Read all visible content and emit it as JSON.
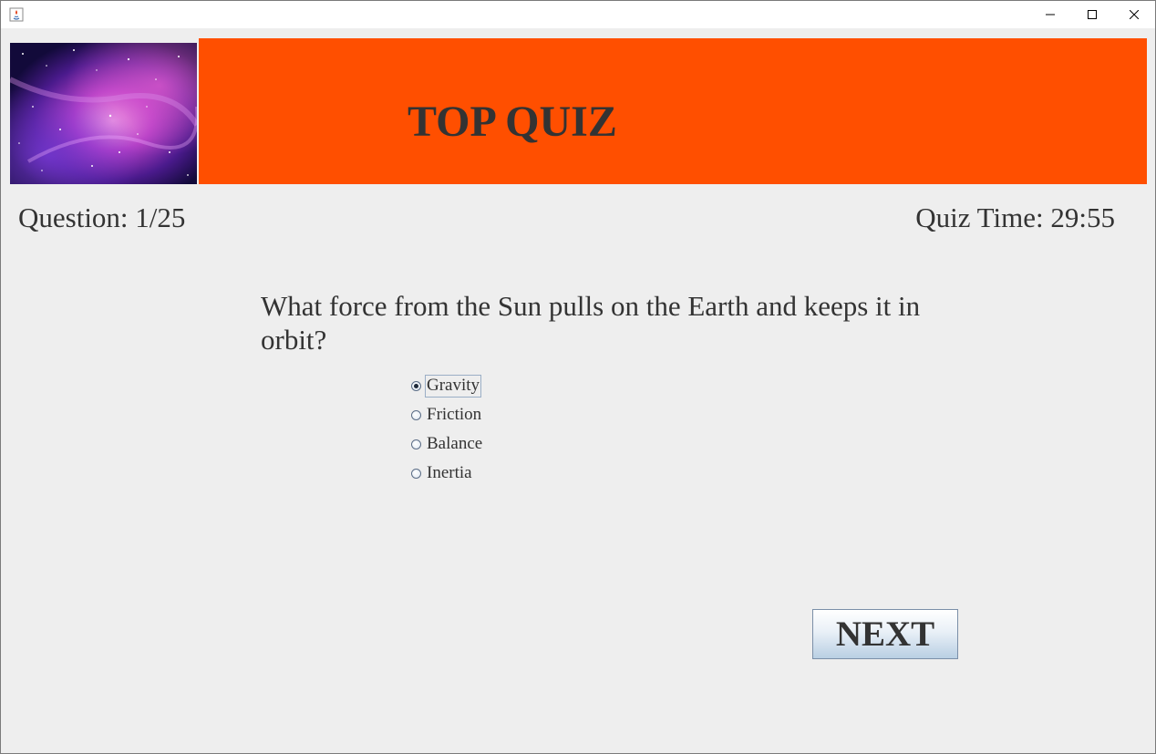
{
  "window": {
    "controls": [
      "minimize-icon",
      "maximize-icon",
      "close-icon"
    ]
  },
  "banner": {
    "title": "TOP QUIZ",
    "color": "#ff4f00",
    "image": "galaxy-nebula-image"
  },
  "status": {
    "question_counter": "Question: 1/25",
    "timer": "Quiz Time: 29:55"
  },
  "question": {
    "text": "What force from the Sun pulls on the Earth and keeps it in orbit?"
  },
  "options": [
    {
      "label": "Gravity",
      "selected": true
    },
    {
      "label": "Friction",
      "selected": false
    },
    {
      "label": "Balance",
      "selected": false
    },
    {
      "label": "Inertia",
      "selected": false
    }
  ],
  "actions": {
    "next_label": "NEXT"
  }
}
